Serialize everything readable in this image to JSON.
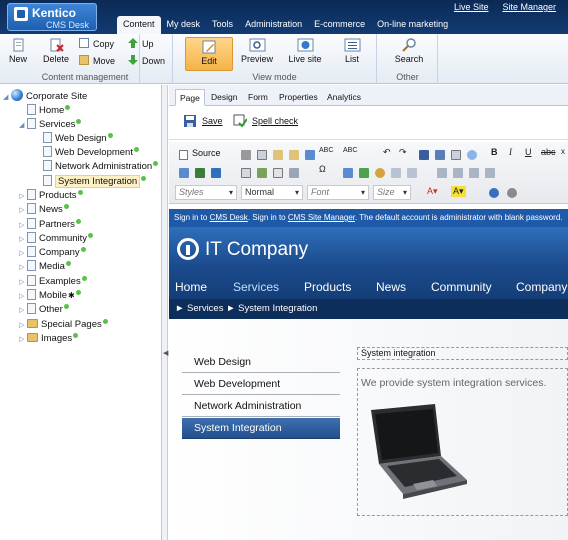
{
  "header": {
    "logo_name": "Kentico",
    "logo_sub": "CMS Desk",
    "tabs": [
      "Content",
      "My desk",
      "Tools",
      "Administration",
      "E-commerce",
      "On-line marketing"
    ],
    "top_links": [
      "Live Site",
      "Site Manager"
    ]
  },
  "ribbon": {
    "content_management": {
      "label": "Content management",
      "new": "New",
      "delete": "Delete",
      "copy": "Copy",
      "move": "Move",
      "up": "Up",
      "down": "Down"
    },
    "view_mode": {
      "label": "View mode",
      "edit": "Edit",
      "preview": "Preview",
      "live_site": "Live site",
      "list": "List"
    },
    "other": {
      "label": "Other",
      "search": "Search"
    }
  },
  "tree": {
    "root": "Corporate Site",
    "home": "Home",
    "services": "Services",
    "services_children": [
      "Web Design",
      "Web Development",
      "Network Administration",
      "System Integration"
    ],
    "products": "Products",
    "news": "News",
    "partners": "Partners",
    "community": "Community",
    "company": "Company",
    "media": "Media",
    "examples": "Examples",
    "mobile": "Mobile",
    "other": "Other",
    "special_pages": "Special Pages",
    "images": "Images"
  },
  "content_tabs": [
    "Page",
    "Design",
    "Form",
    "Properties",
    "Analytics"
  ],
  "actions": {
    "save": "Save",
    "spell_check": "Spell check"
  },
  "editor": {
    "source": "Source",
    "styles": "Styles",
    "format": "Normal",
    "font": "Font",
    "size": "Size"
  },
  "site": {
    "signin_text_1": "Sign in to ",
    "signin_link_1": "CMS Desk",
    "signin_text_2": ". Sign in to ",
    "signin_link_2": "CMS Site Manager",
    "signin_text_3": ". The default account is administrator with blank password.",
    "company_name": "IT Company",
    "nav": [
      "Home",
      "Services",
      "Products",
      "News",
      "Community",
      "Company"
    ],
    "breadcrumb": "► Services ► System Integration",
    "side_menu": [
      "Web Design",
      "Web Development",
      "Network Administration",
      "System Integration"
    ],
    "webpart_title": "System integration",
    "body_text": "We provide system integration services."
  }
}
